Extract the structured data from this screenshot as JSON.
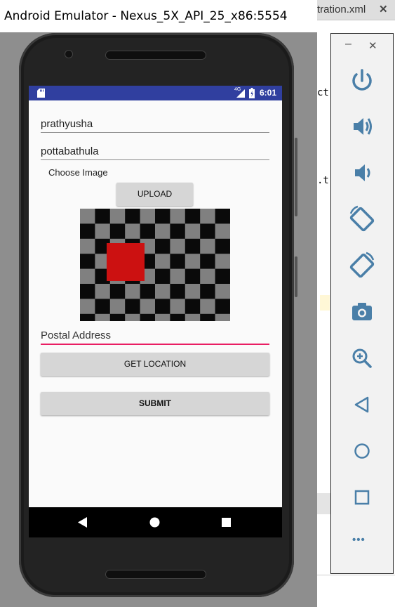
{
  "window": {
    "title": "Android Emulator - Nexus_5X_API_25_x86:5554"
  },
  "editor": {
    "tab_label": "tration.xml",
    "tab_close": "✕",
    "code_fragment_1": "ct",
    "code_fragment_2": ".t"
  },
  "status_bar": {
    "network": "4G",
    "time": "6:01"
  },
  "form": {
    "first_name_value": "prathyusha",
    "last_name_value": "pottabathula",
    "choose_image_label": "Choose Image",
    "upload_label": "UPLOAD",
    "address_placeholder": "Postal Address",
    "get_location_label": "GET LOCATION",
    "submit_label": "SUBMIT"
  },
  "controls": {
    "minimize": "–",
    "close": "✕",
    "more": "•••"
  },
  "colors": {
    "status_bar": "#303f9f",
    "accent_underline": "#e91e63",
    "image_square": "#cc1111",
    "control_icon": "#4a7fa8"
  }
}
